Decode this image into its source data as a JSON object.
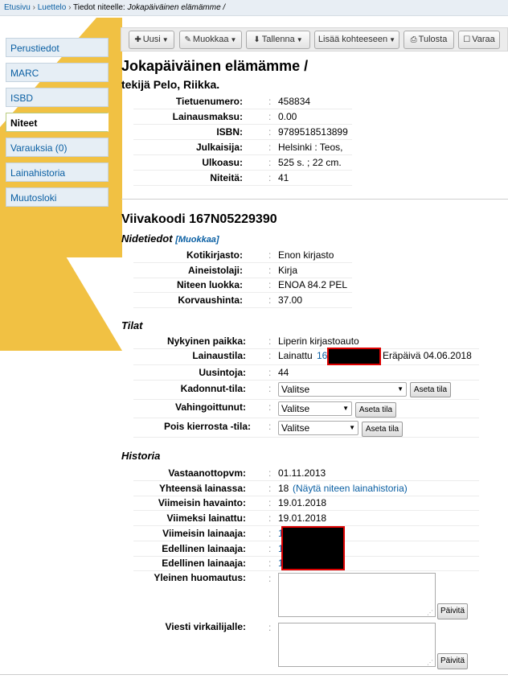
{
  "breadcrumb": {
    "home": "Etusivu",
    "sep": "›",
    "catalog": "Luettelo",
    "items_label": "Tiedot niteelle:",
    "title": "Jokapäiväinen elämämme /"
  },
  "sidebar": {
    "items": [
      {
        "label": "Perustiedot"
      },
      {
        "label": "MARC"
      },
      {
        "label": "ISBD"
      },
      {
        "label": "Niteet"
      },
      {
        "label": "Varauksia (0)"
      },
      {
        "label": "Lainahistoria"
      },
      {
        "label": "Muutosloki"
      }
    ]
  },
  "toolbar": {
    "new": "Uusi",
    "edit": "Muokkaa",
    "save": "Tallenna",
    "add_to": "Lisää kohteeseen",
    "print": "Tulosta",
    "hold": "Varaa"
  },
  "record": {
    "title": "Jokapäiväinen elämämme /",
    "author": "tekijä Pelo, Riikka.",
    "fields": [
      {
        "label": "Tietuenumero:",
        "value": "458834"
      },
      {
        "label": "Lainausmaksu:",
        "value": "0.00"
      },
      {
        "label": "ISBN:",
        "value": "9789518513899"
      },
      {
        "label": "Julkaisija:",
        "value": "Helsinki : Teos,"
      },
      {
        "label": "Ulkoasu:",
        "value": "525 s. ; 22 cm."
      },
      {
        "label": "Niteitä:",
        "value": "41"
      }
    ]
  },
  "item": {
    "barcode_heading": "Viivakoodi 167N05229390",
    "details_heading": "Nidetiedot",
    "edit_link": "[Muokkaa]",
    "details": [
      {
        "label": "Kotikirjasto:",
        "value": "Enon kirjasto"
      },
      {
        "label": "Aineistolaji:",
        "value": "Kirja"
      },
      {
        "label": "Niteen luokka:",
        "value": "ENOA 84.2 PEL"
      },
      {
        "label": "Korvaushinta:",
        "value": "37.00"
      }
    ]
  },
  "status": {
    "heading": "Tilat",
    "current_location_label": "Nykyinen paikka:",
    "current_location": "Liperin kirjastoauto",
    "checkout_label": "Lainaustila:",
    "checkout_prefix": "Lainattu",
    "checkout_link": "167",
    "due": "Eräpäivä 04.06.2018",
    "renewals_label": "Uusintoja:",
    "renewals": "44",
    "lost_label": "Kadonnut-tila:",
    "lost_value": "Valitse",
    "damaged_label": "Vahingoittunut:",
    "damaged_value": "Valitse",
    "withdrawn_label": "Pois kierrosta -tila:",
    "withdrawn_value": "Valitse",
    "set_status": "Aseta tila"
  },
  "history": {
    "heading": "Historia",
    "accession_label": "Vastaanottopvm:",
    "accession": "01.11.2013",
    "total_checkouts_label": "Yhteensä lainassa:",
    "total_checkouts": "18",
    "show_history": "(Näytä niteen lainahistoria)",
    "last_seen_label": "Viimeisin havainto:",
    "last_seen": "19.01.2018",
    "last_borrowed_label": "Viimeksi lainattu:",
    "last_borrowed": "19.01.2018",
    "last_borrower_label": "Viimeisin lainaaja:",
    "prev_borrower_label": "Edellinen lainaaja:",
    "borrower_prefix": "1",
    "public_note_label": "Yleinen huomautus:",
    "staff_note_label": "Viesti virkailijalle:",
    "update": "Päivitä"
  },
  "colors": {
    "accent_yellow": "#f1c143",
    "link": "#0a5fa3"
  },
  "icons": {
    "new": "plus-icon",
    "edit": "pencil-icon",
    "save": "download-icon",
    "print": "printer-icon",
    "hold": "bookmark-icon"
  }
}
